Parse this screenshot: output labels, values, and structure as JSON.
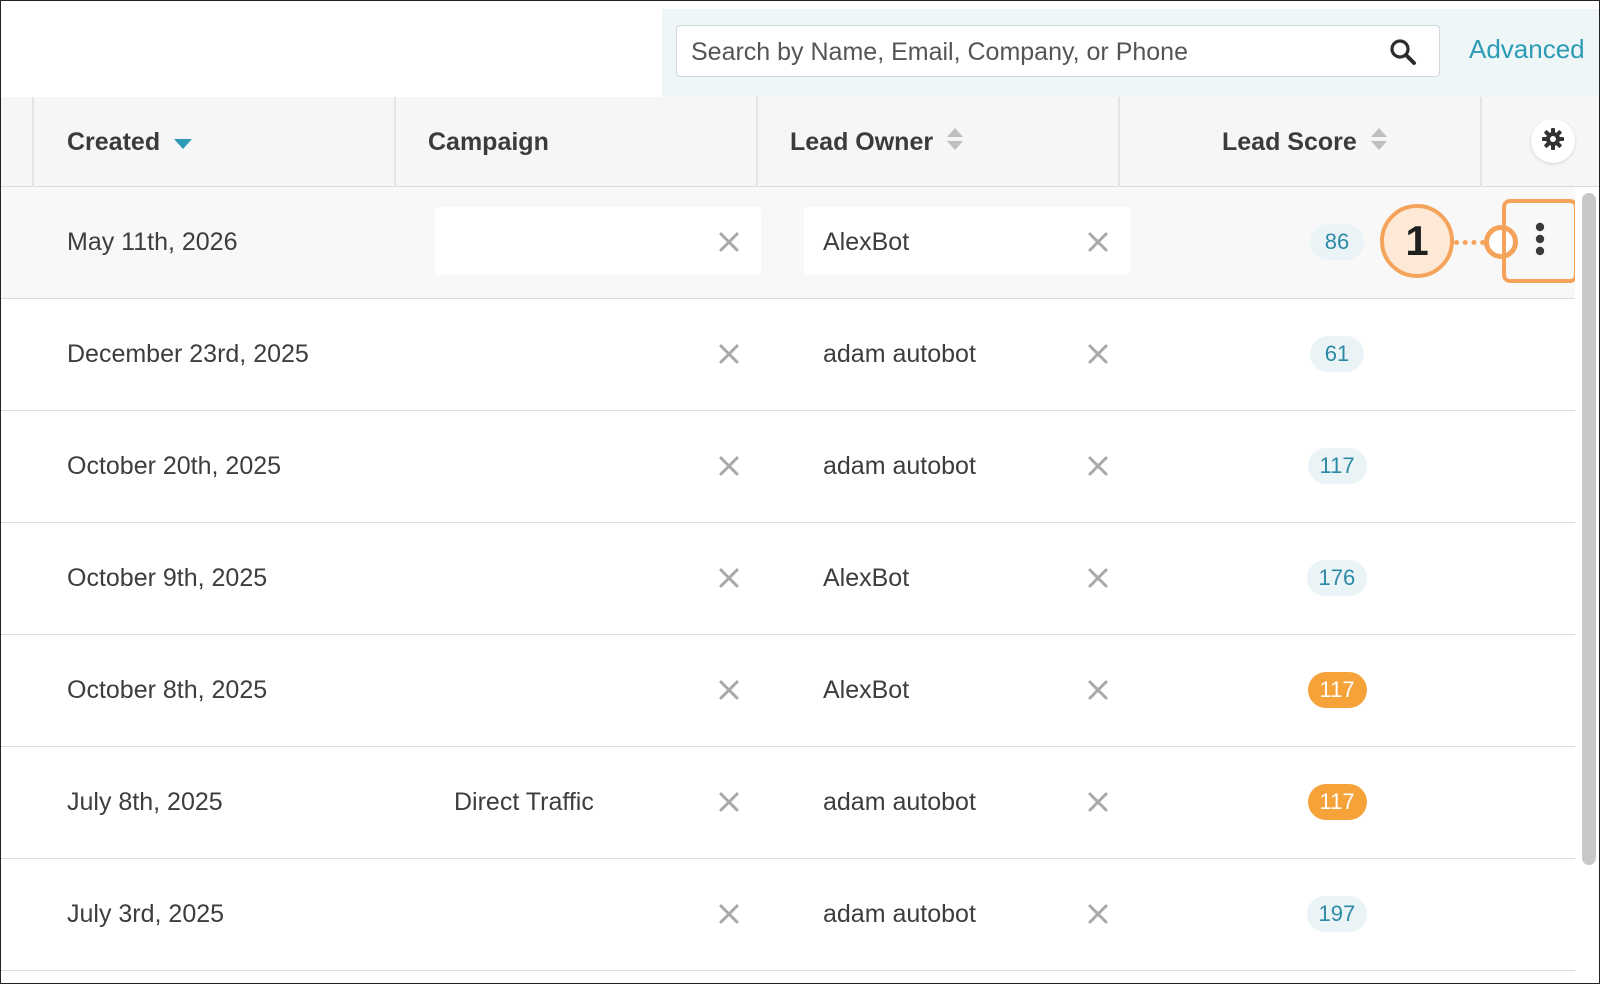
{
  "search": {
    "placeholder": "Search by Name, Email, Company, or Phone",
    "advanced_label": "Advanced"
  },
  "table": {
    "columns": [
      {
        "label": "Created",
        "sort": "desc-active"
      },
      {
        "label": "Campaign",
        "sort": "none"
      },
      {
        "label": "Lead Owner",
        "sort": "sortable"
      },
      {
        "label": "Lead Score",
        "sort": "sortable"
      }
    ],
    "settings_icon": "gear-icon",
    "rows": [
      {
        "created": "May 11th, 2026",
        "campaign": "",
        "owner": "AlexBot",
        "score": "86",
        "score_style": "blue"
      },
      {
        "created": "December 23rd, 2025",
        "campaign": "",
        "owner": "adam autobot",
        "score": "61",
        "score_style": "blue"
      },
      {
        "created": "October 20th, 2025",
        "campaign": "",
        "owner": "adam autobot",
        "score": "117",
        "score_style": "blue"
      },
      {
        "created": "October 9th, 2025",
        "campaign": "",
        "owner": "AlexBot",
        "score": "176",
        "score_style": "blue"
      },
      {
        "created": "October 8th, 2025",
        "campaign": "",
        "owner": "AlexBot",
        "score": "117",
        "score_style": "orange"
      },
      {
        "created": "July 8th, 2025",
        "campaign": "Direct Traffic",
        "owner": "adam autobot",
        "score": "117",
        "score_style": "orange"
      },
      {
        "created": "July 3rd, 2025",
        "campaign": "",
        "owner": "adam autobot",
        "score": "197",
        "score_style": "blue"
      }
    ]
  },
  "annotation": {
    "step_number": "1",
    "target": "row-actions-kebab"
  },
  "colors": {
    "accent": "#2d9bb5",
    "highlight_orange": "#f5a35a",
    "badge_orange": "#f5a338",
    "badge_blue_bg": "#eaf4f7"
  }
}
